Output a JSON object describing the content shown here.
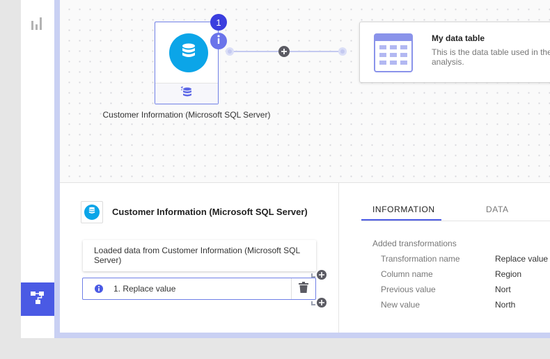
{
  "sidebar": {
    "items": [
      {
        "icon": "bar-chart-icon"
      },
      {
        "icon": "data-flow-icon",
        "active": true
      }
    ]
  },
  "canvas": {
    "source_node": {
      "label": "Customer Information (Microsoft SQL Server)",
      "badge_count": "1",
      "icon": "database-icon"
    },
    "data_table_node": {
      "title": "My data table",
      "description": "This is the data table used in the analysis."
    }
  },
  "details": {
    "node_title": "Customer Information (Microsoft SQL Server)",
    "steps": [
      {
        "label": "Loaded data from Customer Information (Microsoft SQL Server)"
      },
      {
        "label": "1. Replace value"
      }
    ],
    "tabs": [
      {
        "label": "INFORMATION",
        "active": true
      },
      {
        "label": "DATA",
        "active": false
      }
    ],
    "info": {
      "heading": "Added transformations",
      "rows": [
        {
          "key": "Transformation name",
          "value": "Replace value"
        },
        {
          "key": "Column name",
          "value": "Region"
        },
        {
          "key": "Previous value",
          "value": "Nort"
        },
        {
          "key": "New value",
          "value": "North"
        }
      ]
    }
  },
  "colors": {
    "accent": "#4a5ae4",
    "source_blue": "#0ba5e8",
    "badge_dark": "#3b3ede"
  }
}
